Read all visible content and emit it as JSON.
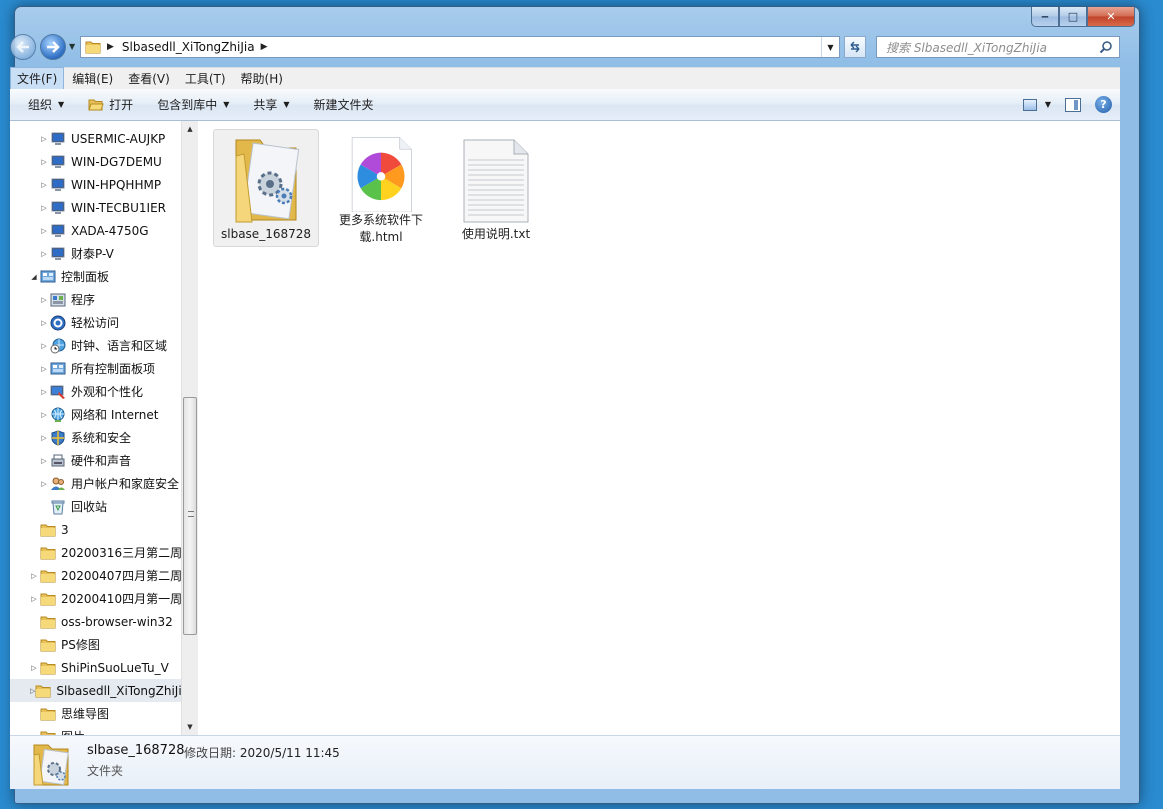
{
  "window": {
    "controls": {
      "minimize": "‒",
      "maximize": "□",
      "close": "✕"
    }
  },
  "address": {
    "path": "Slbasedll_XiTongZhiJia",
    "search_placeholder": "搜索 Slbasedll_XiTongZhiJia"
  },
  "menubar": {
    "items": [
      "文件(F)",
      "编辑(E)",
      "查看(V)",
      "工具(T)",
      "帮助(H)"
    ]
  },
  "toolbar": {
    "organize": "组织",
    "open": "打开",
    "include_library": "包含到库中",
    "share": "共享",
    "new_folder": "新建文件夹"
  },
  "tree": {
    "items": [
      {
        "label": "USERMIC-AUJKP",
        "icon": "computer-icon"
      },
      {
        "label": "WIN-DG7DEMU",
        "icon": "computer-icon"
      },
      {
        "label": "WIN-HPQHHMP",
        "icon": "computer-icon"
      },
      {
        "label": "WIN-TECBU1IER",
        "icon": "computer-icon"
      },
      {
        "label": "XADA-4750G",
        "icon": "computer-icon"
      },
      {
        "label": "财泰P-V",
        "icon": "computer-icon"
      },
      {
        "label": "控制面板",
        "icon": "control-panel-icon"
      },
      {
        "label": "程序",
        "icon": "programs-icon"
      },
      {
        "label": "轻松访问",
        "icon": "ease-of-access-icon"
      },
      {
        "label": "时钟、语言和区域",
        "icon": "clock-language-icon"
      },
      {
        "label": "所有控制面板项",
        "icon": "control-panel-icon"
      },
      {
        "label": "外观和个性化",
        "icon": "appearance-icon"
      },
      {
        "label": "网络和 Internet",
        "icon": "network-icon"
      },
      {
        "label": "系统和安全",
        "icon": "security-icon"
      },
      {
        "label": "硬件和声音",
        "icon": "hardware-icon"
      },
      {
        "label": "用户帐户和家庭安全",
        "icon": "users-icon"
      },
      {
        "label": "回收站",
        "icon": "recycle-bin-icon"
      },
      {
        "label": "3",
        "icon": "folder-icon"
      },
      {
        "label": "20200316三月第二周",
        "icon": "folder-icon"
      },
      {
        "label": "20200407四月第二周",
        "icon": "folder-icon"
      },
      {
        "label": "20200410四月第一周",
        "icon": "folder-icon"
      },
      {
        "label": "oss-browser-win32",
        "icon": "folder-icon"
      },
      {
        "label": "PS修图",
        "icon": "folder-icon"
      },
      {
        "label": "ShiPinSuoLueTu_V",
        "icon": "folder-icon"
      },
      {
        "label": "Slbasedll_XiTongZhiJia",
        "icon": "folder-icon"
      },
      {
        "label": "思维导图",
        "icon": "folder-icon"
      },
      {
        "label": "图片",
        "icon": "folder-icon"
      }
    ]
  },
  "files": [
    {
      "name": "slbase_168728",
      "icon": "settings-folder-icon"
    },
    {
      "name": "更多系统软件下载.html",
      "icon": "browser-icon"
    },
    {
      "name": "使用说明.txt",
      "icon": "text-file-icon"
    }
  ],
  "details": {
    "name": "slbase_168728",
    "modified_label": "修改日期:",
    "modified_value": "2020/5/11 11:45",
    "type": "文件夹"
  }
}
